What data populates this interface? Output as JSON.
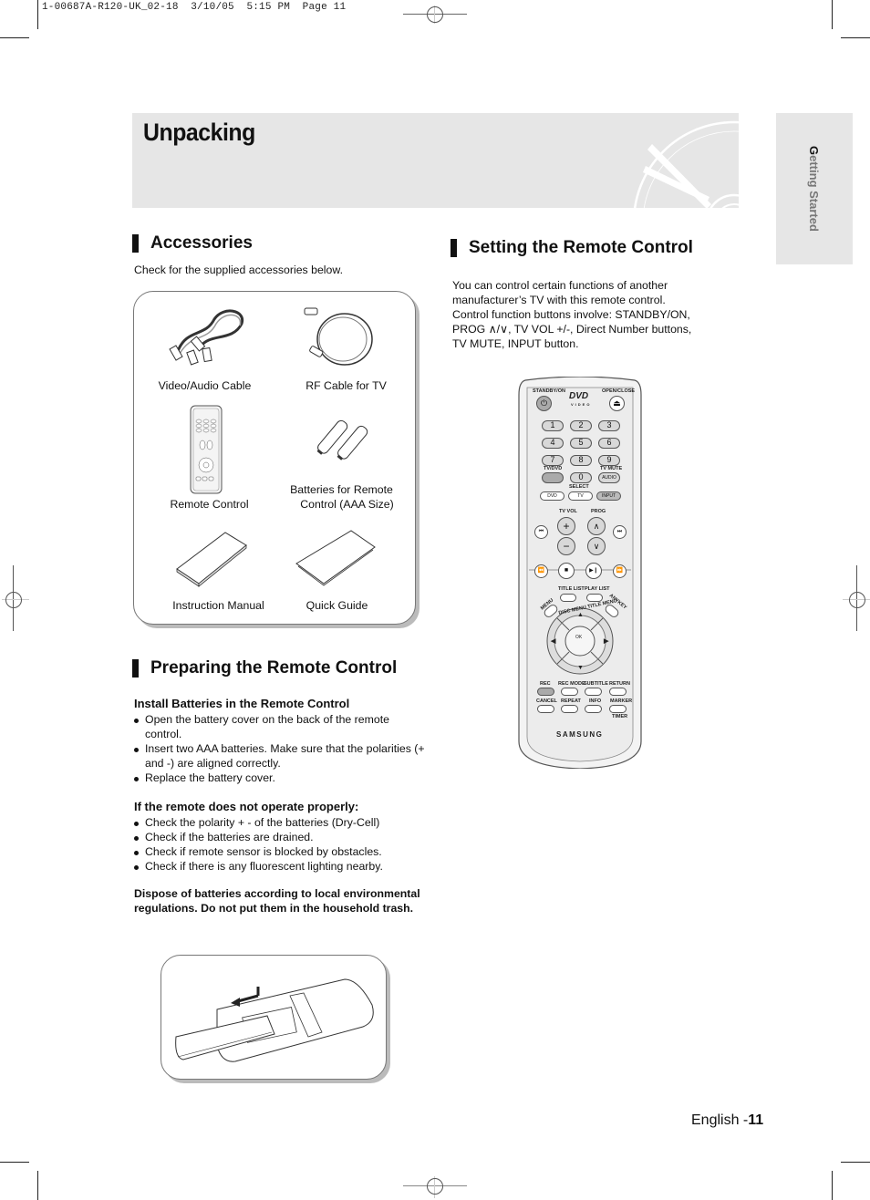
{
  "slug": {
    "file": "1-00687A-R120-UK_02-18",
    "date": "3/10/05",
    "time": "5:15 PM",
    "page": "Page 11"
  },
  "header": {
    "title": "Unpacking",
    "side_tab": {
      "first_letter": "G",
      "rest": "etting Started"
    }
  },
  "accessories": {
    "heading": "Accessories",
    "intro": "Check for the supplied accessories below.",
    "items": [
      {
        "label": "Video/Audio Cable",
        "icon": "av-cable-icon"
      },
      {
        "label": "RF Cable for TV",
        "icon": "rf-cable-icon"
      },
      {
        "label": "Remote Control",
        "icon": "remote-control-icon"
      },
      {
        "label_line1": "Batteries for Remote",
        "label_line2": "Control (AAA Size)",
        "icon": "batteries-icon"
      },
      {
        "label": "Instruction Manual",
        "icon": "manual-icon"
      },
      {
        "label": "Quick Guide",
        "icon": "quick-guide-icon"
      }
    ]
  },
  "preparing": {
    "heading": "Preparing the Remote Control",
    "install_title": "Install Batteries in the Remote Control",
    "install_steps": [
      "Open the battery cover on the back of the remote control.",
      "Insert two AAA batteries. Make sure that the polarities (+ and -) are aligned correctly.",
      "Replace the battery cover."
    ],
    "trouble_title": "If the remote does not operate properly:",
    "trouble_steps": [
      "Check the polarity + - of the batteries (Dry-Cell)",
      "Check if the batteries are drained.",
      "Check if remote sensor is blocked by obstacles.",
      "Check if there is any fluorescent lighting nearby."
    ],
    "dispose_note": "Dispose of batteries according to local environmental regulations. Do not put them in the household trash."
  },
  "setting": {
    "heading": "Setting the Remote Control",
    "para_line1": "You can control certain functions of another",
    "para_line2": "manufacturer’s TV with this remote control.",
    "para_line3": "Control function buttons involve: STANDBY/ON,",
    "para_line4_a": "PROG ",
    "para_line4_sym": "∧/∨",
    "para_line4_b": ", TV VOL +/-, Direct Number buttons,",
    "para_line5": "TV MUTE, INPUT button."
  },
  "remote": {
    "standby_label": "STANDBY/ON",
    "standby_symbol": "⏻",
    "dvd_logo": "DVD",
    "dvd_sub": "VIDEO",
    "open_close_label": "OPEN/CLOSE",
    "eject_symbol": "⏏",
    "numbers": [
      "1",
      "2",
      "3",
      "4",
      "5",
      "6",
      "7",
      "8",
      "9"
    ],
    "zero": "0",
    "tvdvd_label": "TV/DVD",
    "tvmute_label": "TV MUTE",
    "audio_label": "AUDIO",
    "select_label": "SELECT",
    "select_buttons": [
      "DVD",
      "TV",
      "INPUT"
    ],
    "tvvol_label": "TV VOL",
    "prog_label": "PROG",
    "vol_plus": "+",
    "vol_minus": "−",
    "prog_up": "∧",
    "prog_down": "∨",
    "skip_back": "⏮",
    "skip_fwd": "⏭",
    "rew": "⏪",
    "stop": "■",
    "play_pause": "▶❙",
    "ffwd": "⏩",
    "menu_label": "MENU",
    "title_list": "TITLE LIST",
    "play_list": "PLAY LIST",
    "anykey": "ANYKEY",
    "disc_menu": "DISC MENU",
    "title_menu": "TITLE MENU",
    "ok": "OK",
    "rec": "REC",
    "rec_mode": "REC MODE",
    "subtitle": "SUBTITLE",
    "return": "RETURN",
    "cancel": "CANCEL",
    "repeat": "REPEAT",
    "info": "INFO",
    "marker": "MARKER",
    "timer": "TIMER",
    "brand": "SAMSUNG"
  },
  "footer": {
    "lang": "English -",
    "page_number": "11"
  }
}
